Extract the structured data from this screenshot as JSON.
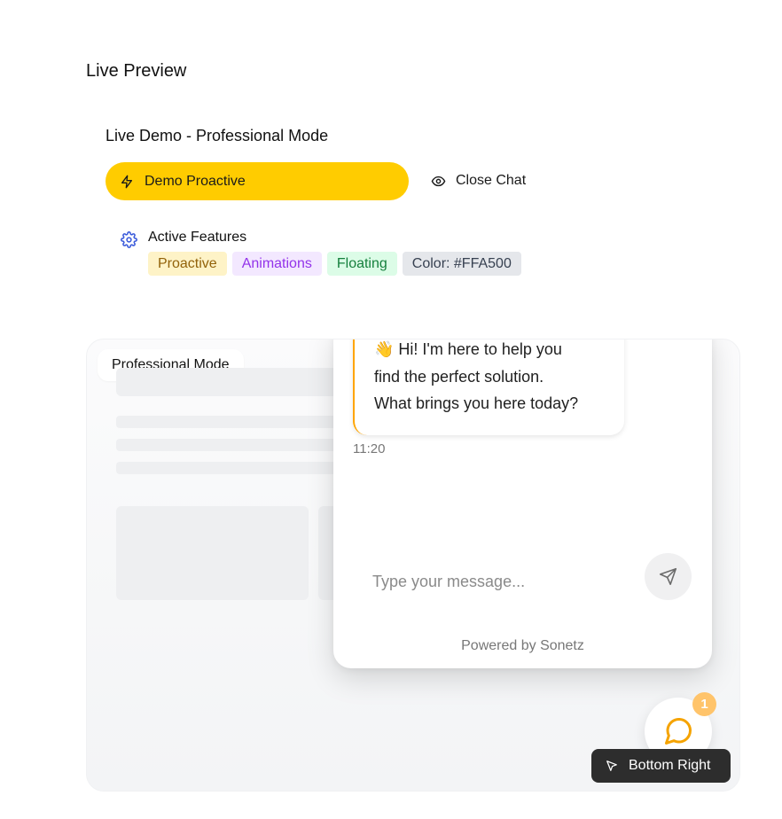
{
  "section": {
    "title": "Live Preview"
  },
  "demo": {
    "title": "Live Demo - Professional Mode",
    "proactive_button": "Demo Proactive",
    "close_button": "Close Chat"
  },
  "features": {
    "label": "Active Features",
    "tags": [
      "Proactive",
      "Animations",
      "Floating",
      "Color: #FFA500"
    ]
  },
  "preview": {
    "mode_label": "Professional Mode",
    "chat": {
      "message_lines": [
        "👋 Hi! I'm here to help you",
        "find the perfect solution.",
        "What brings you here today?"
      ],
      "time": "11:20",
      "input_placeholder": "Type your message...",
      "powered_by": "Powered by Sonetz"
    },
    "unread_count": "1",
    "position_label": "Bottom Right"
  },
  "colors": {
    "accent": "#FFCC00",
    "chat_accent": "#FFA500",
    "badge": "#FFC46B",
    "gear_icon": "#3B5BDB"
  },
  "icons": {
    "proactive": "lightning-icon",
    "close": "eye-icon",
    "features": "gear-icon",
    "send": "send-icon",
    "launcher": "chat-bubble-icon",
    "position": "cursor-arrow-icon"
  }
}
